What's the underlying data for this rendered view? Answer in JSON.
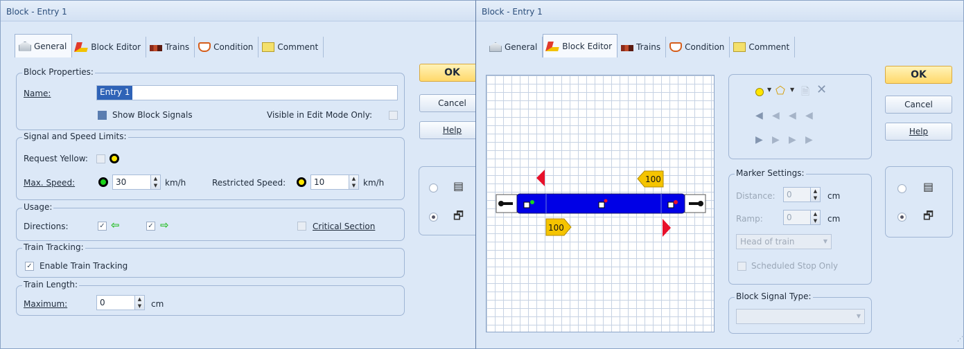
{
  "window1": {
    "title": "Block - Entry 1",
    "tabs": [
      "General",
      "Block Editor",
      "Trains",
      "Condition",
      "Comment"
    ],
    "block_properties": {
      "group_title": "Block Properties:",
      "name_label": "Name:",
      "name_value": "Entry 1",
      "show_signals_label": "Show Block Signals",
      "visible_label": "Visible in Edit Mode Only:"
    },
    "signal_speed": {
      "group_title": "Signal and Speed Limits:",
      "request_yellow_label": "Request Yellow:",
      "max_speed_label": "Max. Speed:",
      "max_speed_value": "30",
      "unit": "km/h",
      "restricted_label": "Restricted Speed:",
      "restricted_value": "10"
    },
    "usage": {
      "group_title": "Usage:",
      "directions_label": "Directions:",
      "critical_label": "Critical Section"
    },
    "tracking": {
      "group_title": "Train Tracking:",
      "enable_label": "Enable Train Tracking"
    },
    "length": {
      "group_title": "Train Length:",
      "maximum_label": "Maximum:",
      "maximum_value": "0",
      "unit": "cm"
    },
    "buttons": {
      "ok": "OK",
      "cancel": "Cancel",
      "help": "Help"
    }
  },
  "window2": {
    "title": "Block - Entry 1",
    "tabs": [
      "General",
      "Block Editor",
      "Trains",
      "Condition",
      "Comment"
    ],
    "editor": {
      "marker_top": "100",
      "marker_bottom": "100"
    },
    "marker_settings": {
      "group_title": "Marker Settings:",
      "distance_label": "Distance:",
      "distance_value": "0",
      "ramp_label": "Ramp:",
      "ramp_value": "0",
      "unit": "cm",
      "position_value": "Head of train",
      "scheduled_label": "Scheduled Stop Only"
    },
    "signal_type": {
      "group_title": "Block Signal Type:"
    },
    "buttons": {
      "ok": "OK",
      "cancel": "Cancel",
      "help": "Help"
    }
  },
  "colors": {
    "accent_ok": "#ffd86a",
    "block": "#0000e6",
    "marker": "#f5c400",
    "signal_red": "#e8102a",
    "selection": "#2f63b7"
  }
}
